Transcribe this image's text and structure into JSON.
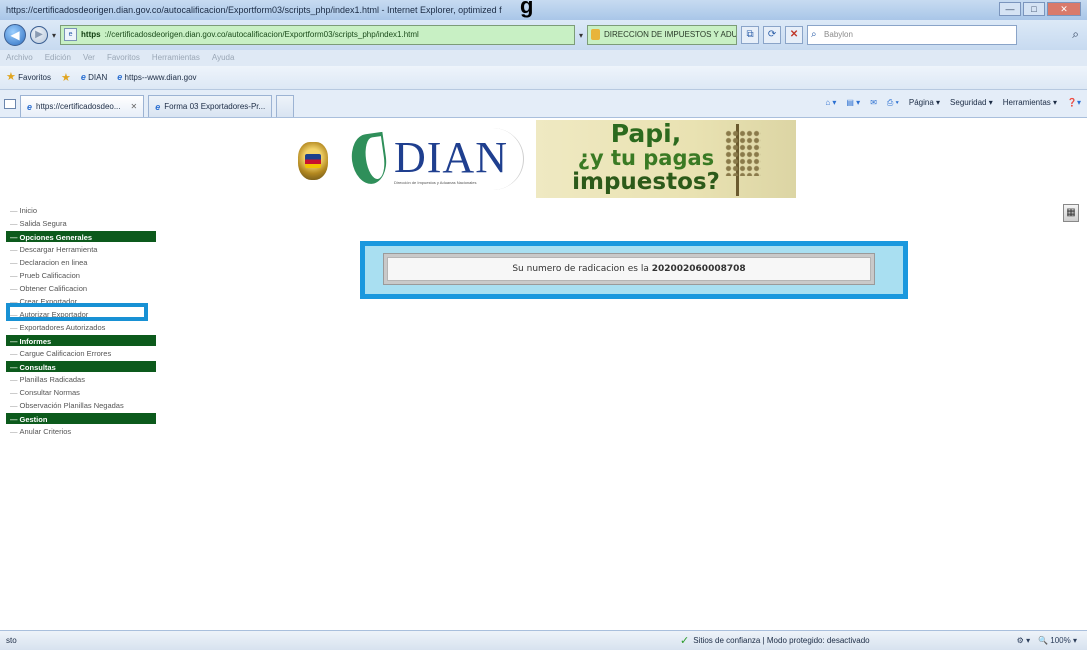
{
  "window": {
    "title": "https://certificadosdeorigen.dian.gov.co/autocalificacion/Exportform03/scripts_php/index1.html - Internet Explorer, optimized f",
    "overlay_text": "g",
    "controls": [
      "—",
      "□",
      "✕"
    ]
  },
  "address_bar": {
    "url_scheme": "https",
    "url_rest": "://certificadosdeorigen.dian.gov.co/autocalificacion/Exportform03/scripts_php/index1.html",
    "cert_label": "DIRECCION DE IMPUESTOS Y ADUA...",
    "search_placeholder": "Babylon"
  },
  "menu_bar": [
    "Archivo",
    "Edición",
    "Ver",
    "Favoritos",
    "Herramientas",
    "Ayuda"
  ],
  "favorites_bar": {
    "favorites_label": "Favoritos",
    "items": [
      "DIAN",
      "https--www.dian.gov"
    ]
  },
  "tabs": [
    {
      "label": "https://certificadosdeo...",
      "active": true
    },
    {
      "label": "Forma 03 Exportadores-Pr...",
      "active": false
    }
  ],
  "command_bar": {
    "page": "Página ▾",
    "safety": "Seguridad ▾",
    "tools": "Herramientas ▾"
  },
  "banner": {
    "logo_text": "DIAN",
    "logo_sub": "Dirección de Impuestos y Aduanas Nacionales",
    "ad_line1": "Papi,",
    "ad_line2": "¿y tu pagas",
    "ad_line3": "impuestos?"
  },
  "side_menu": {
    "top_items": [
      "Inicio",
      "Salida Segura"
    ],
    "sections": [
      {
        "header": "Opciones Generales",
        "items": [
          "Descargar Herramienta",
          "Declaracion en linea",
          "Prueb Calificacion",
          "Obtener Calificacion",
          "Crear Exportador",
          "Autorizar Exportador",
          "Exportadores Autorizados"
        ]
      },
      {
        "header": "Informes",
        "items": [
          "Cargue Calificacion Errores"
        ]
      },
      {
        "header": "Consultas",
        "items": [
          "Planillas Radicadas",
          "Consultar Normas",
          "Observación Planillas Negadas"
        ]
      },
      {
        "header": "Gestion",
        "items": [
          "Anular Criterios"
        ]
      }
    ],
    "highlighted_item": "Obtener Calificacion"
  },
  "notice": {
    "prefix": "Su numero de radicacion es la ",
    "number": "202002060008708"
  },
  "status_bar": {
    "left": "sto",
    "zone": "Sitios de confianza | Modo protegido: desactivado",
    "zoom": "100%"
  },
  "colors": {
    "menu_header_bg": "#0c5a1c",
    "highlight_border": "#1891d4",
    "notice_border": "#1a98de",
    "notice_bg": "#a9dff1",
    "dian_blue": "#1f3f8f"
  }
}
